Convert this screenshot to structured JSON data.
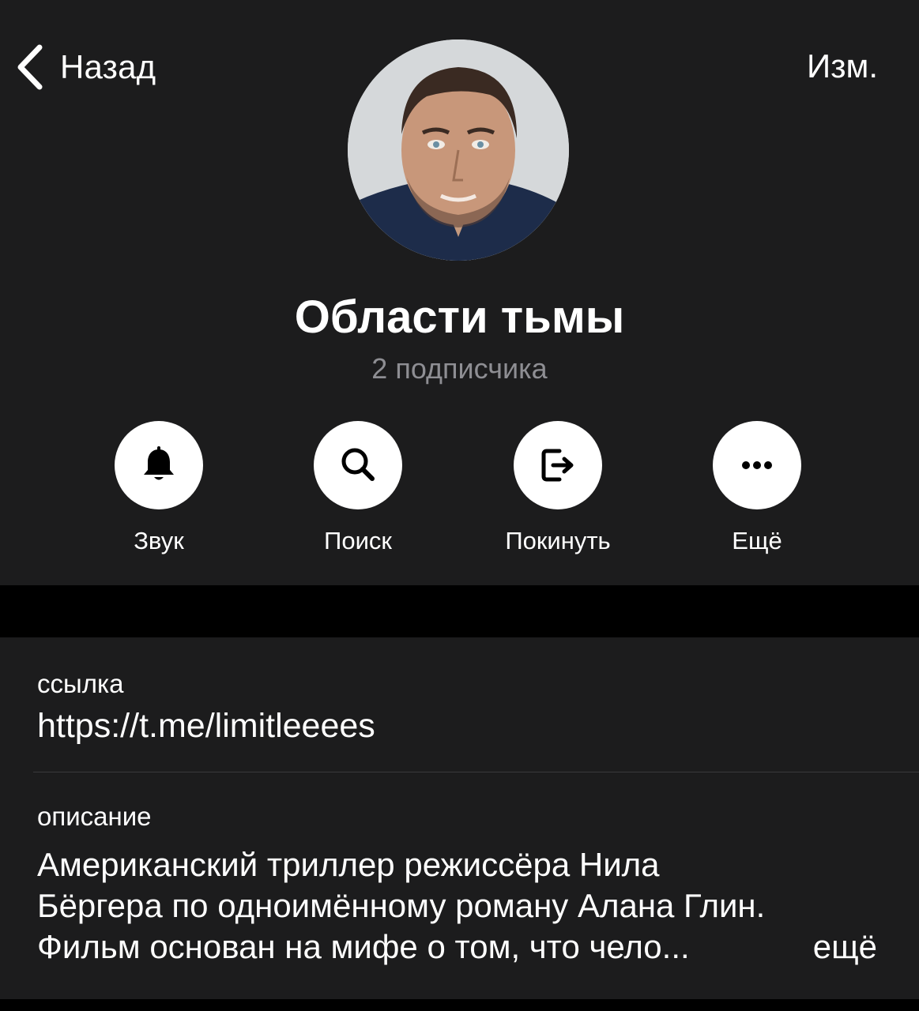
{
  "nav": {
    "back_label": "Назад",
    "edit_label": "Изм."
  },
  "channel": {
    "title": "Области тьмы",
    "subscribers": "2 подписчика"
  },
  "actions": [
    {
      "label": "Звук",
      "icon": "bell-icon"
    },
    {
      "label": "Поиск",
      "icon": "search-icon"
    },
    {
      "label": "Покинуть",
      "icon": "leave-icon"
    },
    {
      "label": "Ещё",
      "icon": "more-icon"
    }
  ],
  "info": {
    "link_label": "ссылка",
    "link_value": "https://t.me/limitleeees",
    "description_label": "описание",
    "description_lines": [
      "Американский триллер режиссёра Нила",
      "Бёргера по одноимённому роману Алана Глин.",
      "Фильм основан на мифе о том, что чело..."
    ],
    "more_label": "ещё"
  },
  "colors": {
    "background": "#000000",
    "panel": "#1c1c1d",
    "secondary_text": "#8e8e93",
    "divider": "#3a3a3c"
  }
}
